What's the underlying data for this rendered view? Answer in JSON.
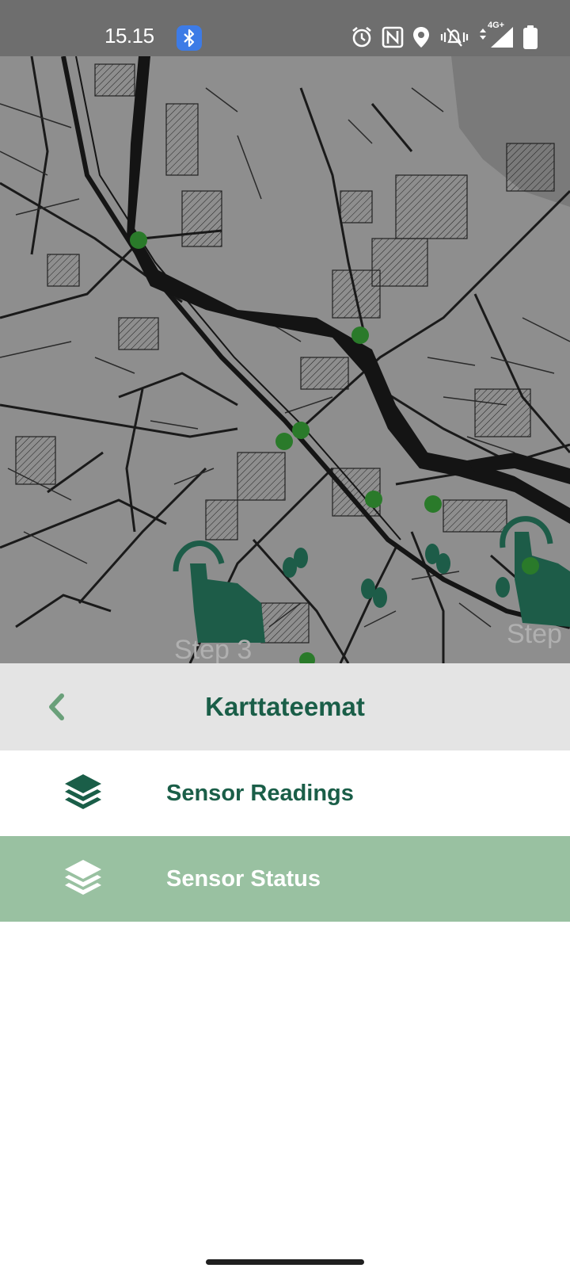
{
  "status_bar": {
    "time": "15.15",
    "network_label": "4G+",
    "icons": [
      "bluetooth-icon",
      "alarm-icon",
      "nfc-icon",
      "location-icon",
      "vibrate-icon",
      "signal-icon",
      "battery-icon"
    ]
  },
  "map": {
    "step_labels": [
      "Step 3",
      "Step"
    ],
    "marker_color": "#2a7a2a"
  },
  "sheet": {
    "title": "Karttateemat",
    "back_icon": "chevron-left-icon"
  },
  "themes": [
    {
      "label": "Sensor Readings",
      "icon": "layers-icon",
      "selected": false
    },
    {
      "label": "Sensor Status",
      "icon": "layers-icon",
      "selected": true
    }
  ],
  "colors": {
    "accent": "#1a5e48",
    "selected_row": "#99c1a1",
    "header_bg": "#e4e4e4"
  }
}
